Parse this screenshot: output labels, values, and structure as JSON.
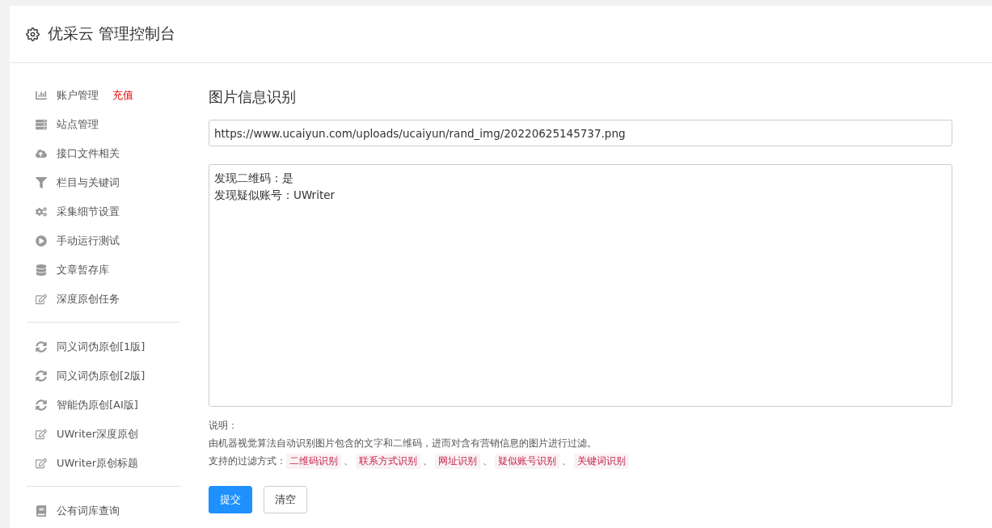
{
  "header": {
    "title": "优采云 管理控制台"
  },
  "sidebar": {
    "groups": [
      {
        "items": [
          {
            "kind": "chart",
            "label": "账户管理",
            "badge": "充值"
          },
          {
            "kind": "server",
            "label": "站点管理"
          },
          {
            "kind": "cloud",
            "label": "接口文件相关"
          },
          {
            "kind": "filter",
            "label": "栏目与关键词"
          },
          {
            "kind": "gears",
            "label": "采集细节设置"
          },
          {
            "kind": "play",
            "label": "手动运行测试"
          },
          {
            "kind": "database",
            "label": "文章暂存库"
          },
          {
            "kind": "edit",
            "label": "深度原创任务"
          }
        ]
      },
      {
        "items": [
          {
            "kind": "refresh",
            "label": "同义词伪原创[1版]"
          },
          {
            "kind": "refresh",
            "label": "同义词伪原创[2版]"
          },
          {
            "kind": "refresh",
            "label": "智能伪原创[AI版]"
          },
          {
            "kind": "edit",
            "label": "UWriter深度原创"
          },
          {
            "kind": "edit",
            "label": "UWriter原创标题"
          }
        ]
      },
      {
        "items": [
          {
            "kind": "book",
            "label": "公有词库查询"
          }
        ]
      }
    ]
  },
  "main": {
    "title": "图片信息识别",
    "url_field": {
      "value": "https://www.ucaiyun.com/uploads/ucaiyun/rand_img/20220625145737.png"
    },
    "result_box": {
      "lines": [
        "发现二维码：是",
        "发现疑似账号：UWriter"
      ]
    },
    "note_label": "说明：",
    "note_text": "由机器视觉算法自动识别图片包含的文字和二维码，进而对含有营销信息的图片进行过滤。",
    "filters_label": "支持的过滤方式：",
    "filters": [
      "二维码识别",
      "联系方式识别",
      "网址识别",
      "疑似账号识别",
      "关键词识别"
    ],
    "separator": "、",
    "buttons": [
      {
        "kind": "primary",
        "label": "提交"
      },
      {
        "kind": "default",
        "label": "清空"
      }
    ]
  }
}
